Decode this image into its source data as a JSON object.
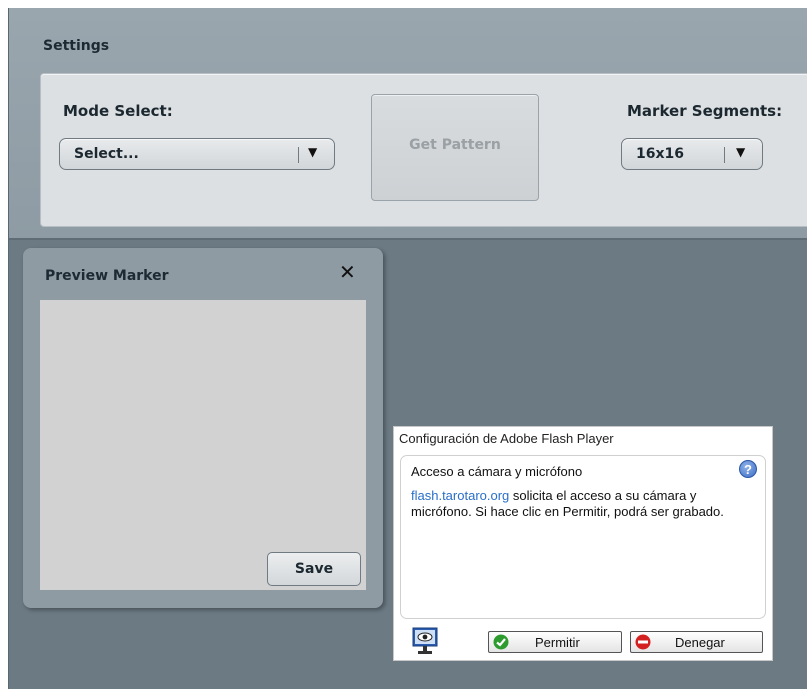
{
  "settings": {
    "title": "Settings",
    "mode_select": {
      "label": "Mode Select:",
      "value": "Select..."
    },
    "get_pattern_label": "Get Pattern",
    "marker_segments": {
      "label": "Marker Segments:",
      "value": "16x16"
    }
  },
  "preview": {
    "title": "Preview Marker",
    "close_glyph": "✕",
    "save_label": "Save"
  },
  "flash_dialog": {
    "title": "Configuración de Adobe Flash Player",
    "heading": "Acceso a cámara y micrófono",
    "help_glyph": "?",
    "message_link": "flash.tarotaro.org",
    "message_rest": " solicita el acceso a su cámara y micrófono. Si hace clic en Permitir, podrá ser grabado.",
    "allow_label": "Permitir",
    "deny_label": "Denegar"
  },
  "colors": {
    "app_bg": "#6c7a84",
    "panel": "#9aa6ae",
    "allow_green": "#2e9b2e",
    "deny_red": "#d42020",
    "link_blue": "#2a6fc9"
  },
  "icons": [
    "chevron-down-icon",
    "close-icon",
    "help-icon",
    "monitor-icon",
    "check-icon",
    "no-entry-icon"
  ]
}
